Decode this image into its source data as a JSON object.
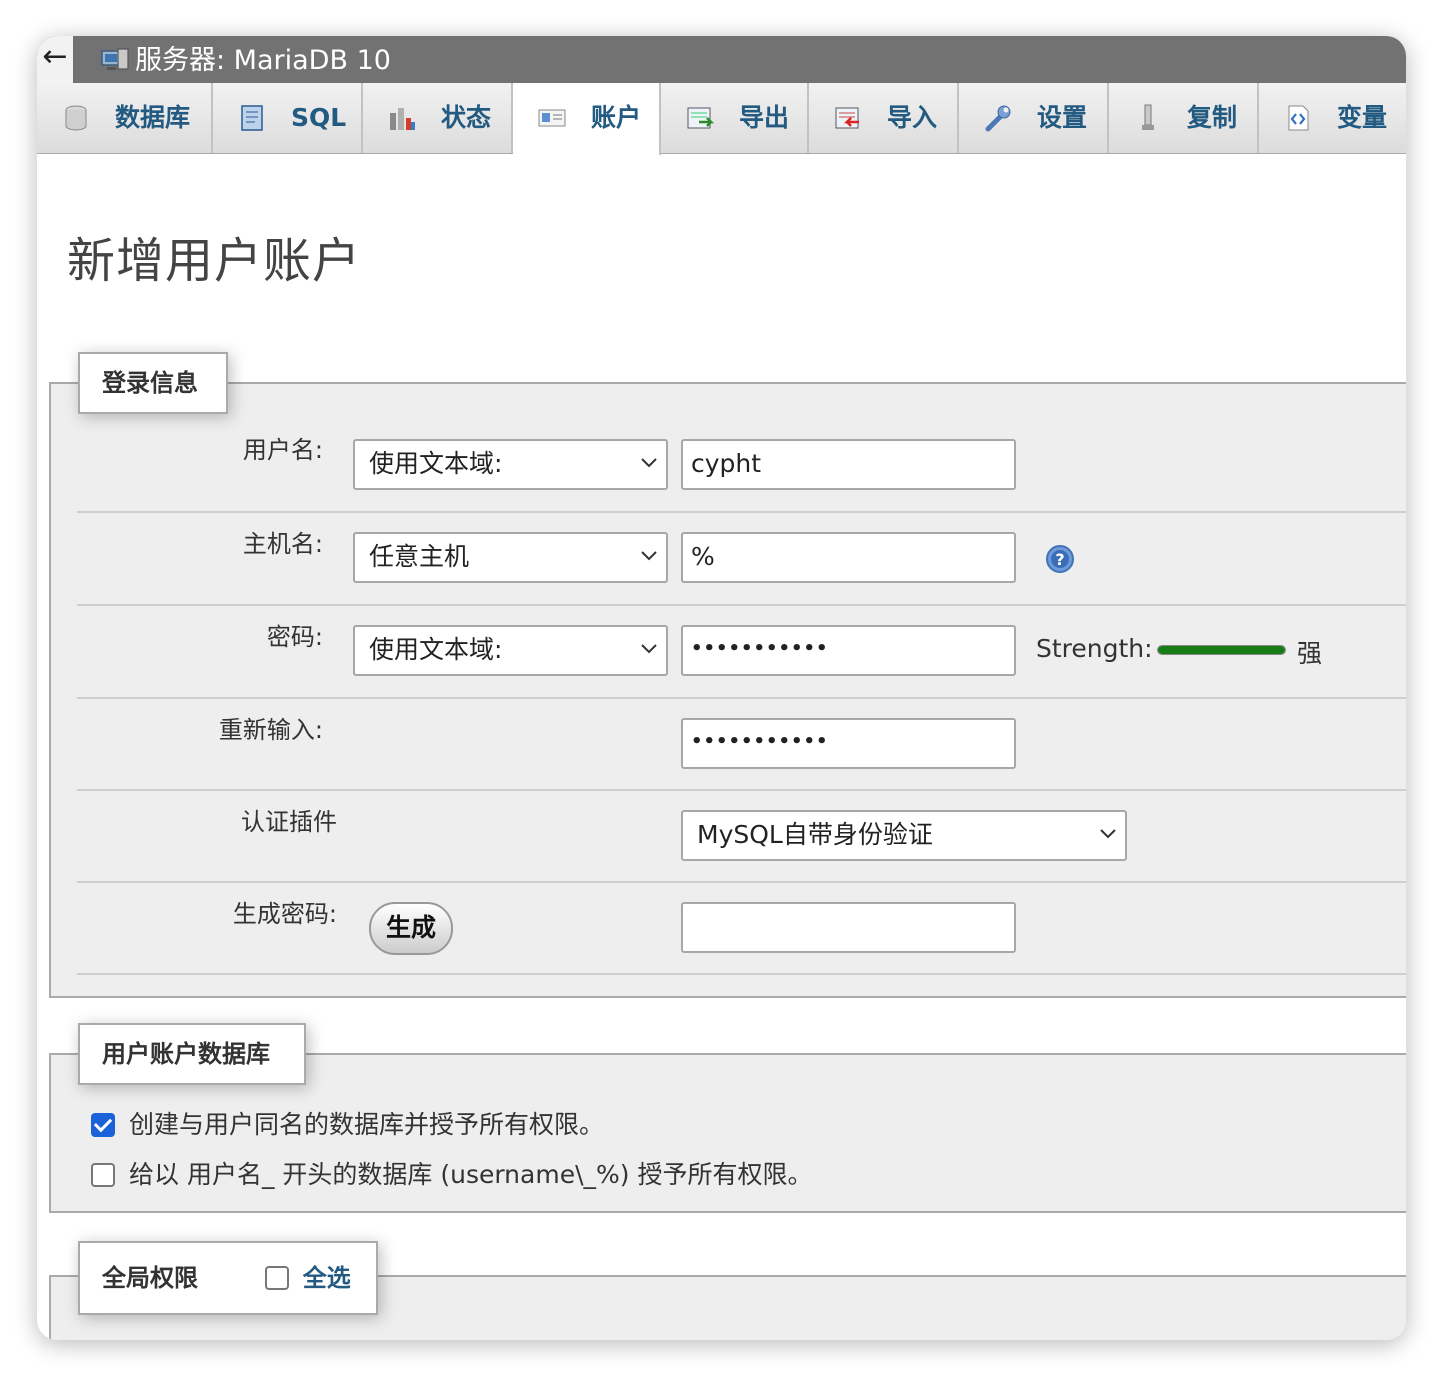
{
  "window": {
    "back_symbol": "←",
    "title": "服务器: MariaDB 10"
  },
  "tabs": [
    {
      "label": "数据库",
      "icon": "database-icon",
      "active": false
    },
    {
      "label": "SQL",
      "icon": "sql-icon",
      "active": false
    },
    {
      "label": "状态",
      "icon": "status-chart-icon",
      "active": false
    },
    {
      "label": "账户",
      "icon": "user-accounts-icon",
      "active": true
    },
    {
      "label": "导出",
      "icon": "export-icon",
      "active": false
    },
    {
      "label": "导入",
      "icon": "import-icon",
      "active": false
    },
    {
      "label": "设置",
      "icon": "wrench-icon",
      "active": false
    },
    {
      "label": "复制",
      "icon": "replication-icon",
      "active": false
    },
    {
      "label": "变量",
      "icon": "variables-icon",
      "active": false
    }
  ],
  "page": {
    "title": "新增用户账户"
  },
  "login_info": {
    "legend": "登录信息",
    "username": {
      "label": "用户名:",
      "select_value": "使用文本域:",
      "input_value": "cypht"
    },
    "hostname": {
      "label": "主机名:",
      "select_value": "任意主机",
      "input_value": "%",
      "help_icon": "help-icon"
    },
    "password": {
      "label": "密码:",
      "select_value": "使用文本域:",
      "masked_value": "•••••••••••",
      "strength_label": "Strength:",
      "strength_fraction": 1.0,
      "strength_text": "强",
      "strength_color": "#167c16"
    },
    "retype": {
      "label": "重新输入:",
      "masked_value": "•••••••••••"
    },
    "auth_plugin": {
      "label": "认证插件",
      "select_value": "MySQL自带身份验证"
    },
    "generate": {
      "label": "生成密码:",
      "button_label": "生成",
      "input_value": ""
    }
  },
  "user_db": {
    "legend": "用户账户数据库",
    "options": [
      {
        "label": "创建与用户同名的数据库并授予所有权限。",
        "checked": true
      },
      {
        "label": "给以 用户名_ 开头的数据库 (username\\_%) 授予所有权限。",
        "checked": false
      }
    ]
  },
  "global_privileges": {
    "legend": "全局权限",
    "select_all_label": "全选",
    "select_all_checked": false
  },
  "colors": {
    "tab_text": "#235a81",
    "titlebar": "#727272",
    "fieldset_bg": "#eeeeee",
    "checkbox_on": "#1a62d8"
  }
}
